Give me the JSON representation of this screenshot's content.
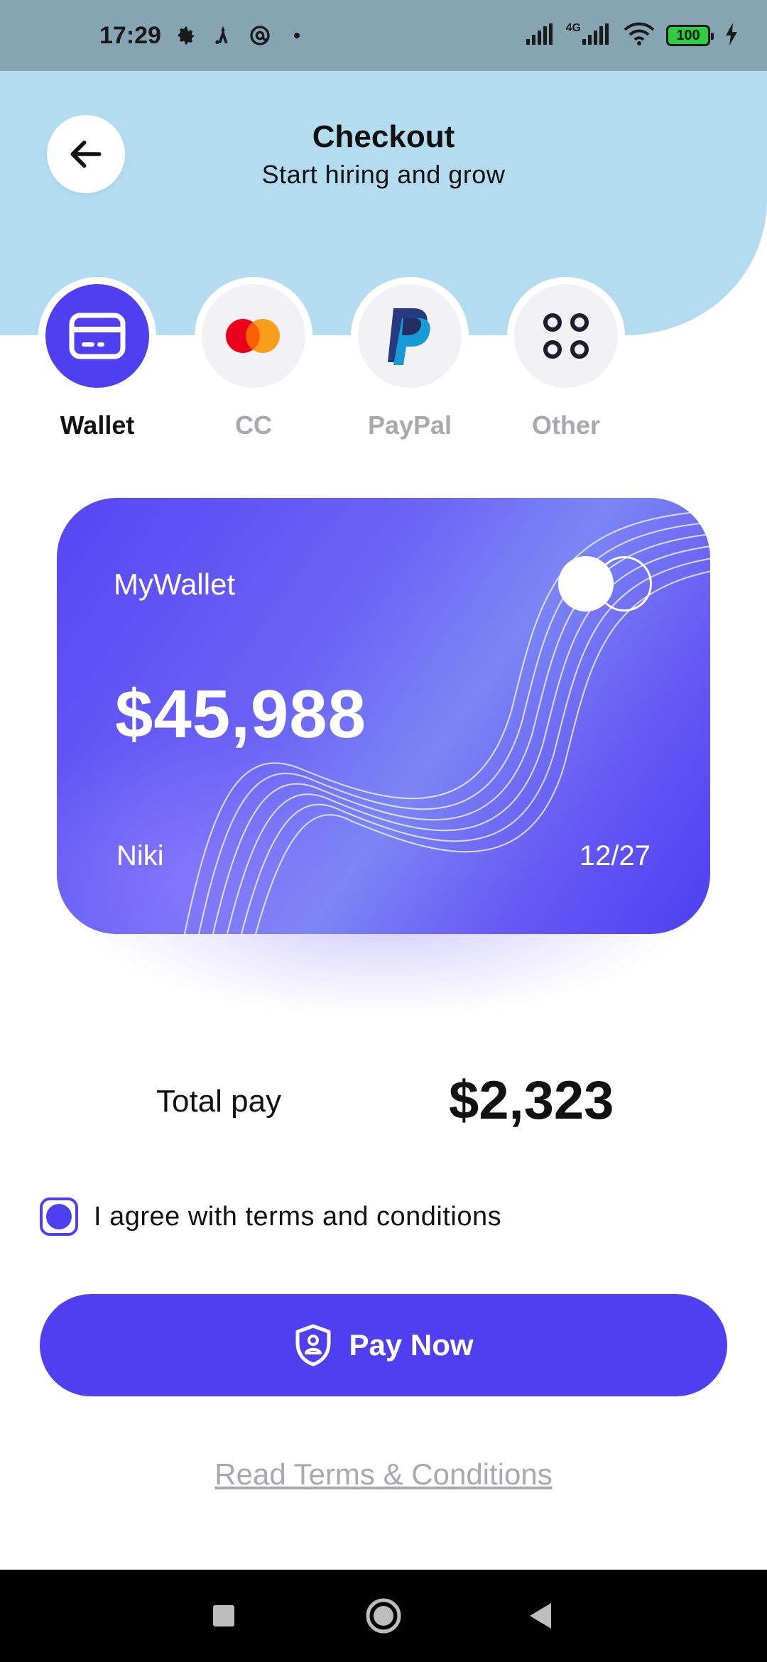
{
  "status_bar": {
    "time": "17:29",
    "network_label": "4G",
    "battery_level": "100"
  },
  "header": {
    "title": "Checkout",
    "subtitle": "Start hiring and grow"
  },
  "payment_methods": [
    {
      "label": "Wallet",
      "icon": "wallet-card-icon",
      "active": true
    },
    {
      "label": "CC",
      "icon": "mastercard-icon",
      "active": false
    },
    {
      "label": "PayPal",
      "icon": "paypal-icon",
      "active": false
    },
    {
      "label": "Other",
      "icon": "grid-dots-icon",
      "active": false
    }
  ],
  "wallet_card": {
    "name": "MyWallet",
    "balance": "$45,988",
    "holder": "Niki",
    "expiry": "12/27"
  },
  "total": {
    "label": "Total pay",
    "value": "$2,323"
  },
  "agreement": {
    "label": "I agree with terms and conditions",
    "checked": true
  },
  "pay_button": {
    "label": "Pay Now"
  },
  "terms_link": {
    "label": "Read Terms & Conditions"
  },
  "colors": {
    "accent": "#4f3ff0",
    "header_bg": "#b3dcf1",
    "status_bar_bg": "#86a5b3"
  }
}
